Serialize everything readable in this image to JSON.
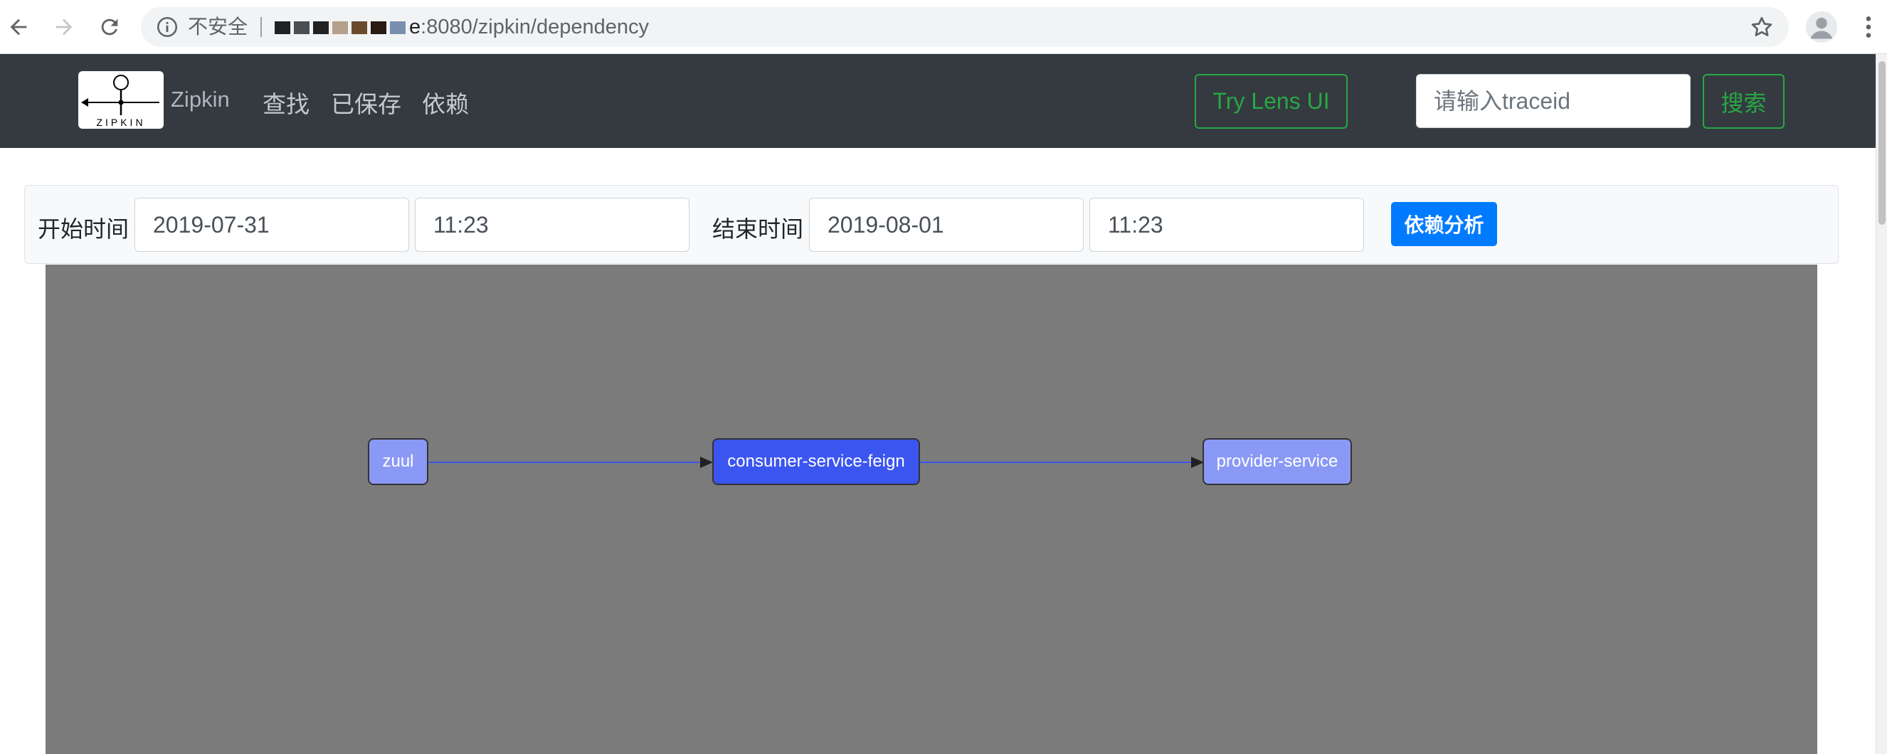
{
  "browser": {
    "security_label": "不安全",
    "url_host_visible": "e",
    "url_path": ":8080/zipkin/dependency"
  },
  "header": {
    "brand": "Zipkin",
    "logo_text": "ZIPKIN",
    "nav": [
      "查找",
      "已保存",
      "依赖"
    ],
    "lens_button": "Try Lens UI",
    "search_placeholder": "请输入traceid",
    "search_button": "搜索"
  },
  "query": {
    "start_label": "开始时间",
    "start_date": "2019-07-31",
    "start_time": "11:23",
    "end_label": "结束时间",
    "end_date": "2019-08-01",
    "end_time": "11:23",
    "analyze_button": "依赖分析"
  },
  "graph": {
    "nodes": [
      {
        "id": "zuul",
        "label": "zuul"
      },
      {
        "id": "consumer-service-feign",
        "label": "consumer-service-feign"
      },
      {
        "id": "provider-service",
        "label": "provider-service"
      }
    ],
    "edges": [
      {
        "from": "zuul",
        "to": "consumer-service-feign"
      },
      {
        "from": "consumer-service-feign",
        "to": "provider-service"
      }
    ],
    "colors": {
      "background": "#7b7b7b",
      "node_light": "#8a99f6",
      "node_selected": "#3b55f0",
      "edge": "#3b55f0"
    }
  }
}
